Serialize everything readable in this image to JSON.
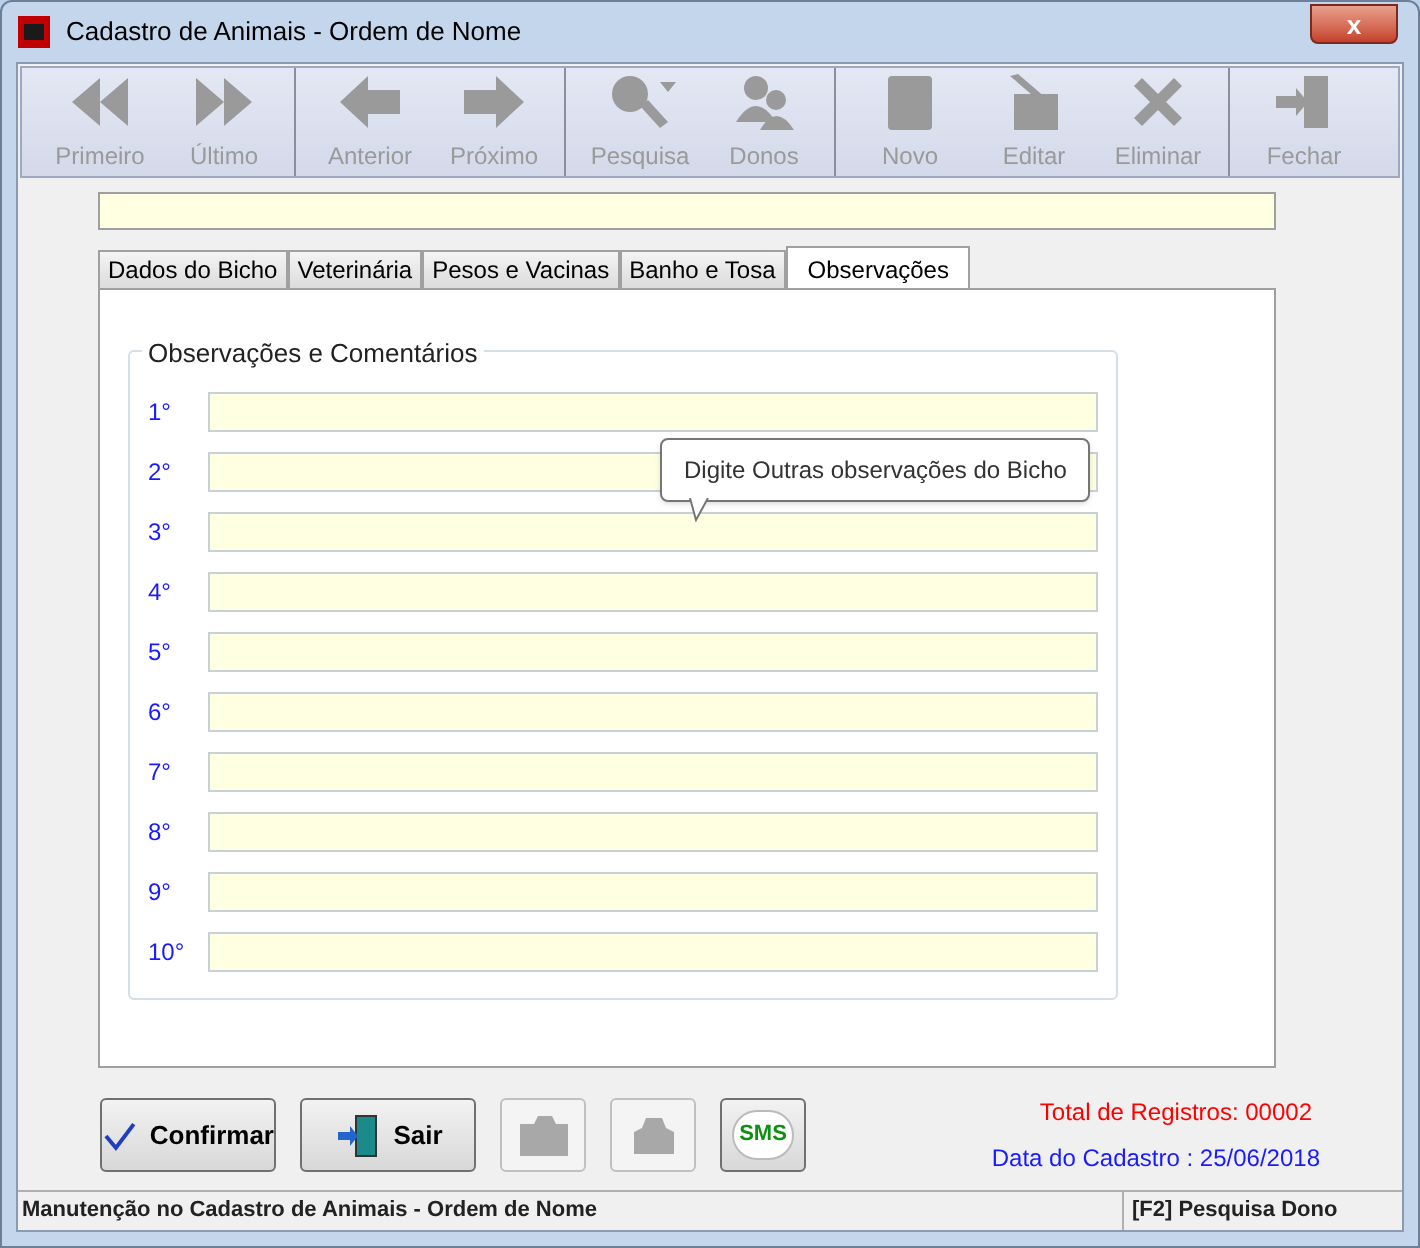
{
  "window": {
    "title": "Cadastro de Animais - Ordem de Nome",
    "close": "x"
  },
  "toolbar": [
    {
      "label": "Primeiro",
      "kind": "first",
      "disabled": true
    },
    {
      "label": "Último",
      "kind": "last",
      "disabled": true
    },
    {
      "label": "Anterior",
      "kind": "prev",
      "disabled": true
    },
    {
      "label": "Próximo",
      "kind": "next",
      "disabled": true
    },
    {
      "label": "Pesquisa",
      "kind": "search",
      "disabled": true
    },
    {
      "label": "Donos",
      "kind": "people",
      "disabled": true
    },
    {
      "label": "Novo",
      "kind": "new",
      "disabled": true
    },
    {
      "label": "Editar",
      "kind": "edit",
      "disabled": true
    },
    {
      "label": "Eliminar",
      "kind": "delete",
      "disabled": true
    },
    {
      "label": "Fechar",
      "kind": "exit",
      "disabled": true
    }
  ],
  "tabs": [
    {
      "label": "Dados do Bicho",
      "selected": false
    },
    {
      "label": "Veterinária",
      "selected": false
    },
    {
      "label": "Pesos e Vacinas",
      "selected": false
    },
    {
      "label": "Banho e Tosa",
      "selected": false
    },
    {
      "label": "Observações",
      "selected": true
    }
  ],
  "group_title": "Observações e Comentários",
  "rows": [
    {
      "label": "1°"
    },
    {
      "label": "2°"
    },
    {
      "label": "3°"
    },
    {
      "label": "4°"
    },
    {
      "label": "5°"
    },
    {
      "label": "6°"
    },
    {
      "label": "7°"
    },
    {
      "label": "8°"
    },
    {
      "label": "9°"
    },
    {
      "label": "10°"
    }
  ],
  "tooltip": "Digite Outras observações do Bicho",
  "buttons": [
    {
      "kind": "confirm",
      "label": "Confirmar",
      "disabled": false
    },
    {
      "kind": "exit",
      "label": "Sair",
      "disabled": false
    },
    {
      "kind": "camera",
      "disabled": true
    },
    {
      "kind": "stamp",
      "disabled": true
    },
    {
      "kind": "sms",
      "label": "SMS",
      "disabled": false
    }
  ],
  "total": "Total de Registros: 00002",
  "date": "Data do Cadastro : 25/06/2018",
  "status_bar": {
    "left": "Manutenção no Cadastro de Animais - Ordem de Nome",
    "right": "[F2] Pesquisa Dono"
  }
}
